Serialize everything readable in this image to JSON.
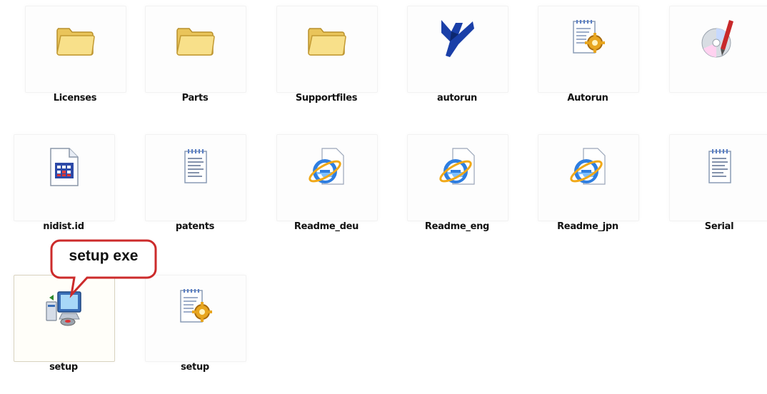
{
  "files": [
    {
      "label": "Licenses",
      "icon": "folder-icon"
    },
    {
      "label": "Parts",
      "icon": "folder-icon"
    },
    {
      "label": "Supportfiles",
      "icon": "folder-icon"
    },
    {
      "label": "autorun",
      "icon": "ni-logo-icon"
    },
    {
      "label": "Autorun",
      "icon": "setup-info-icon"
    },
    {
      "label": "",
      "icon": "cd-icon"
    },
    {
      "label": "nidist.id",
      "icon": "calendar-document-icon"
    },
    {
      "label": "patents",
      "icon": "notepad-icon"
    },
    {
      "label": "Readme_deu",
      "icon": "internet-explorer-icon"
    },
    {
      "label": "Readme_eng",
      "icon": "internet-explorer-icon"
    },
    {
      "label": "Readme_jpn",
      "icon": "internet-explorer-icon"
    },
    {
      "label": "Serial",
      "icon": "notepad-icon"
    },
    {
      "label": "setup",
      "icon": "setup-computer-icon"
    },
    {
      "label": "setup",
      "icon": "setup-info-icon"
    }
  ],
  "callout": {
    "text": "setup exe",
    "color": "#cc2b2b"
  }
}
